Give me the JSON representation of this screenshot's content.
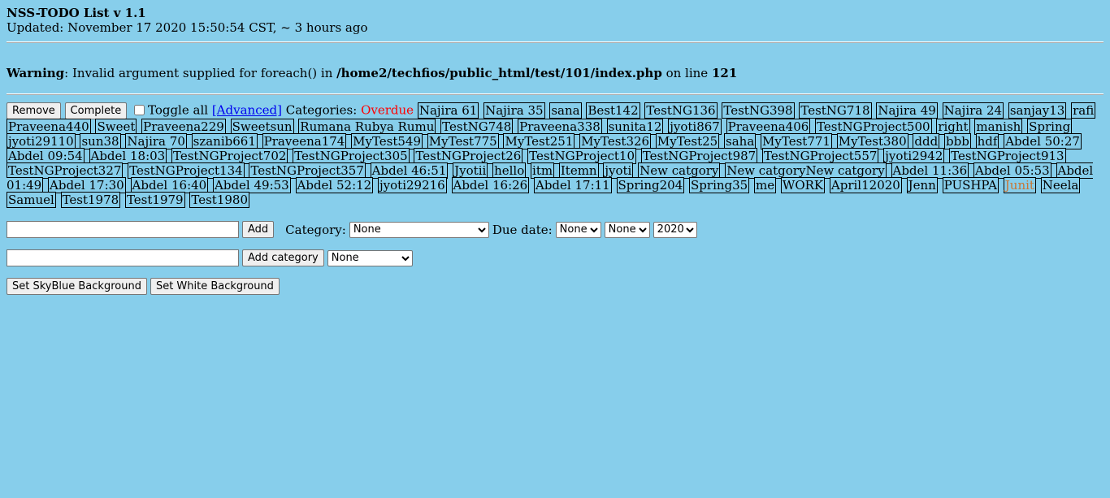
{
  "header": {
    "title": "NSS-TODO List v 1.1",
    "updated": "Updated: November 17 2020 15:50:54 CST, ~ 3 hours ago"
  },
  "warning": {
    "label": "Warning",
    "text_before": ": Invalid argument supplied for foreach() in ",
    "path": "/home2/techfios/public_html/test/101/index.php",
    "text_middle": " on line ",
    "line": "121"
  },
  "toolbar": {
    "remove_label": "Remove",
    "complete_label": "Complete",
    "toggle_all_label": "Toggle all",
    "advanced_label": "[Advanced]",
    "categories_label": "Categories:",
    "overdue_label": "Overdue"
  },
  "categories": [
    "Najira 61",
    "Najira 35",
    "sana",
    "Best142",
    "TestNG136",
    "TestNG398",
    "TestNG718",
    "Najira 49",
    "Najira 24",
    "sanjay13",
    "rafi",
    "Praveena440",
    "Sweet",
    "Praveena229",
    "Sweetsun",
    "Rumana Rubya Rumu",
    "TestNG748",
    "Praveena338",
    "sunita12",
    "jyoti867",
    "Praveena406",
    "TestNGProject500",
    "right",
    "manish",
    "Spring",
    "jyoti29110",
    "sun38",
    "Najira 70",
    "szanib661",
    "Praveena174",
    "MyTest549",
    "MyTest775",
    "MyTest251",
    "MyTest326",
    "MyTest25",
    "saha",
    "MyTest771",
    "MyTest380",
    "ddd",
    "bbb",
    "hdf",
    "Abdel 50:27",
    "Abdel 09:54",
    "Abdel 18:03",
    "TestNGProject702",
    "TestNGProject305",
    "TestNGProject26",
    "TestNGProject10",
    "TestNGProject987",
    "TestNGProject557",
    "jyoti2942",
    "TestNGProject913",
    "TestNGProject327",
    "TestNGProject134",
    "TestNGProject357",
    "Abdel 46:51",
    "Jyotii",
    "hello",
    "itm",
    "Itemn",
    "jyoti",
    "New catgory",
    "New catgoryNew catgory",
    "Abdel 11:36",
    "Abdel 05:53",
    "Abdel 01:49",
    "Abdel 17:30",
    "Abdel 16:40",
    "Abdel 49:53",
    "Abdel 52:12",
    "jyoti29216",
    "Abdel 16:26",
    "Abdel 17:11",
    "Spring204",
    "Spring35",
    "me",
    "WORK",
    "April12020",
    "Jenn",
    "PUSHPA",
    "Junit",
    "Neela",
    "Samuel",
    "Test1978",
    "Test1979",
    "Test1980"
  ],
  "highlight_category": "Junit",
  "add_row": {
    "add_label": "Add",
    "category_label": "Category:",
    "category_value": "None",
    "due_date_label": "Due date:",
    "due_day": "None",
    "due_month": "None",
    "due_year": "2020"
  },
  "add_category_row": {
    "button_label": "Add category",
    "select_value": "None"
  },
  "background_buttons": {
    "skyblue_label": "Set SkyBlue Background",
    "white_label": "Set White Background"
  },
  "colors": {
    "background": "#87CEEB",
    "overdue": "#FF0000",
    "link": "#0000EE",
    "highlight": "#C87533"
  }
}
